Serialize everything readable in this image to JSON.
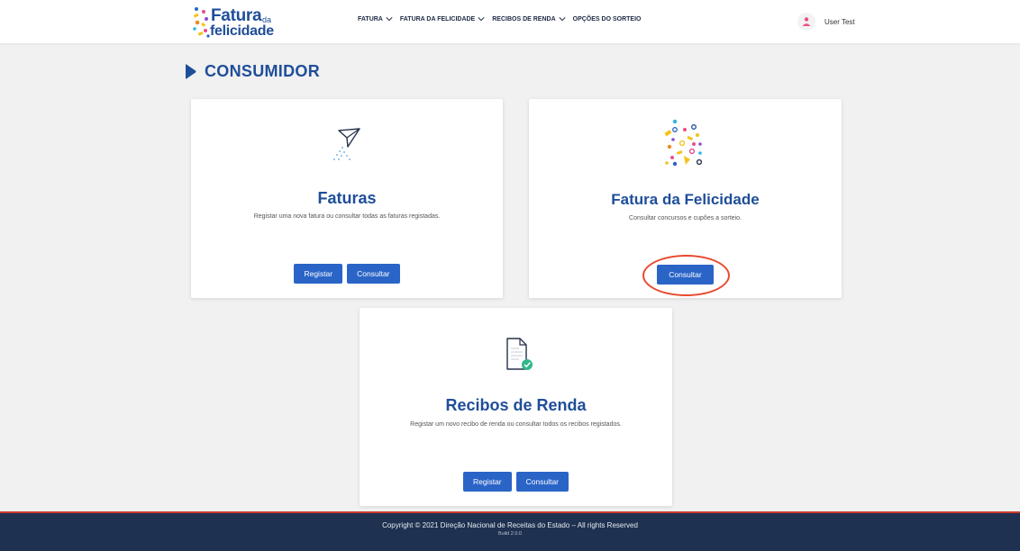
{
  "brand": {
    "word1": "Fatura",
    "da": "da",
    "word2": "felicidade"
  },
  "nav": {
    "items": [
      {
        "label": "FATURA",
        "has_dropdown": true,
        "icon": "chevron-down-icon"
      },
      {
        "label": "FATURA DA FELICIDADE",
        "has_dropdown": true,
        "icon": "chevron-down-icon"
      },
      {
        "label": "RECIBOS DE RENDA",
        "has_dropdown": true,
        "icon": "chevron-down-icon"
      },
      {
        "label": "OPÇÕES DO SORTEIO",
        "has_dropdown": false
      }
    ]
  },
  "user": {
    "name": "User Test",
    "icon": "user-icon"
  },
  "page": {
    "title": "CONSUMIDOR",
    "title_icon": "play-arrow-icon"
  },
  "cards": {
    "faturas": {
      "icon": "paper-plane-icon",
      "title": "Faturas",
      "description": "Registar uma nova fatura ou consultar todas as faturas registadas.",
      "buttons": [
        "Registar",
        "Consultar"
      ]
    },
    "felicidade": {
      "icon": "confetti-icon",
      "title": "Fatura da Felicidade",
      "description": "Consultar concursos e cupões a sorteio.",
      "buttons": [
        "Consultar"
      ]
    },
    "recibos": {
      "icon": "document-check-icon",
      "title": "Recibos de Renda",
      "description": "Registar um novo recibo de renda ou consultar todos os recibos registados.",
      "buttons": [
        "Registar",
        "Consultar"
      ]
    }
  },
  "footer": {
    "copyright": "Copyright © 2021 Direção Nacional de Receitas do Estado – All rights Reserved",
    "build": "Build 2.0.0"
  },
  "colors": {
    "brand_blue": "#1f4e99",
    "button_blue": "#2a64c7",
    "footer_bg": "#1f3150",
    "highlight": "#e8492e"
  }
}
